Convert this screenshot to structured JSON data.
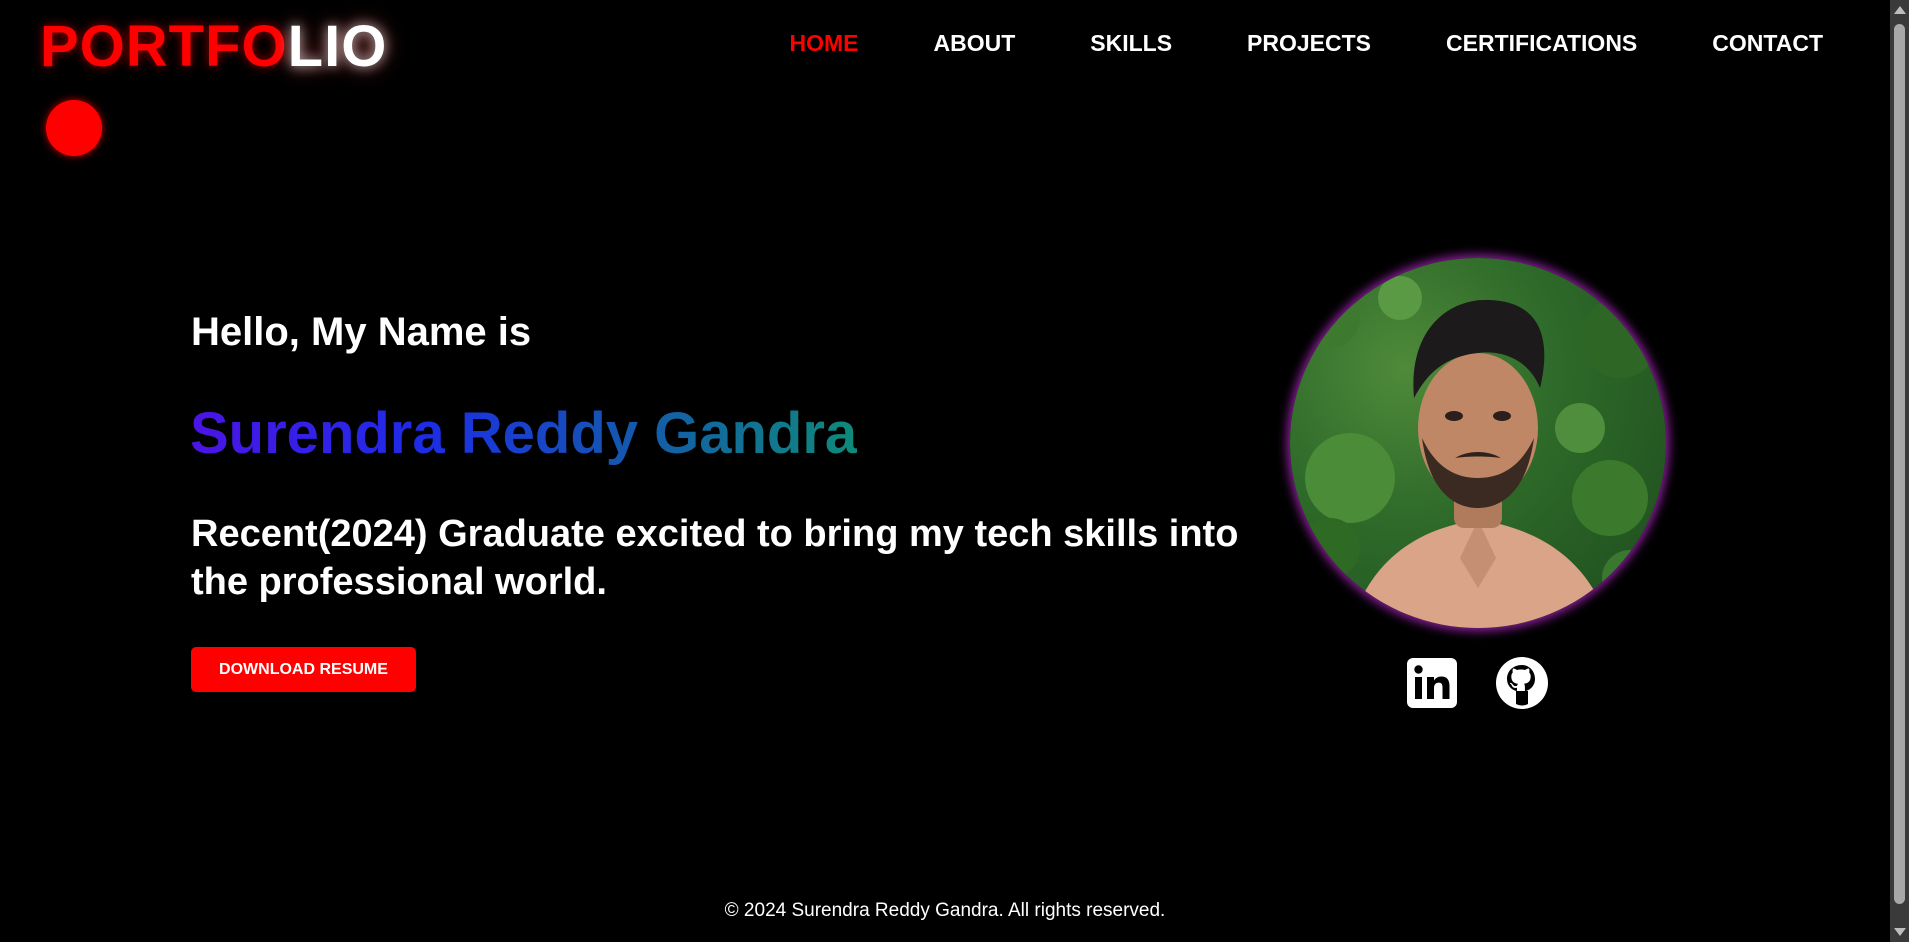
{
  "header": {
    "logo_part1": "PORTFO",
    "logo_part2": "LIO",
    "nav": {
      "home": "HOME",
      "about": "ABOUT",
      "skills": "SKILLS",
      "projects": "PROJECTS",
      "certifications": "CERTIFICATIONS",
      "contact": "CONTACT"
    },
    "active_nav": "HOME"
  },
  "hero": {
    "greeting": "Hello, My Name is",
    "name": "Surendra Reddy Gandra",
    "tagline": "Recent(2024) Graduate excited to bring my tech skills into the professional world.",
    "resume_button": "DOWNLOAD RESUME"
  },
  "social": {
    "icons": [
      "linkedin-icon",
      "github-icon"
    ]
  },
  "footer": {
    "copyright": "© 2024 Surendra Reddy Gandra. All rights reserved."
  },
  "colors": {
    "accent": "#ff0000",
    "background": "#000000",
    "name_gradient_start": "#4b14e6",
    "name_gradient_end": "#0f8a7a",
    "avatar_glow": "#b428c8"
  }
}
